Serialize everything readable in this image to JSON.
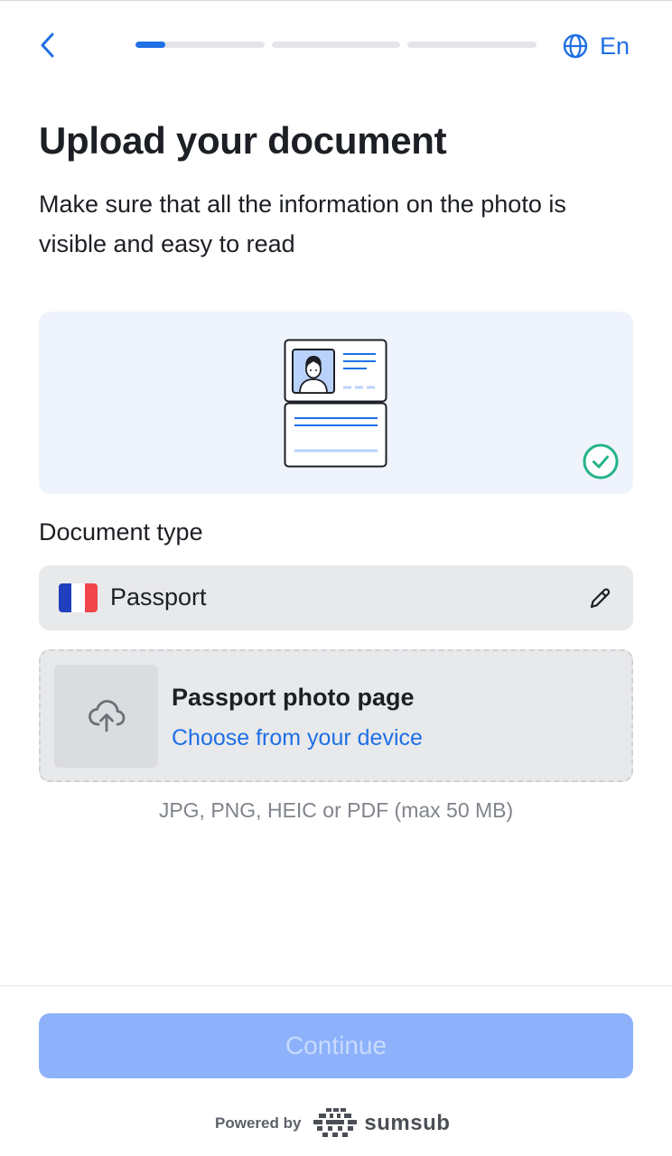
{
  "header": {
    "back_label": "Back",
    "progress": [
      0.23,
      0,
      0
    ],
    "lang_label": "En"
  },
  "title": "Upload your document",
  "subtitle": "Make sure that all the information on the photo is visible and easy to read",
  "document_type": {
    "label": "Document type",
    "selected": "Passport",
    "flag_colors": [
      "#1f3fbf",
      "#ffffff",
      "#f0454b"
    ]
  },
  "upload": {
    "title": "Passport photo page",
    "link": "Choose from your device",
    "formats": "JPG, PNG, HEIC or PDF (max 50 MB)"
  },
  "footer": {
    "continue_label": "Continue",
    "powered_by": "Powered by",
    "brand": "sumsub"
  },
  "colors": {
    "accent": "#1f6fe5",
    "success": "#25b38a",
    "continue_disabled": "#8db2fb"
  }
}
